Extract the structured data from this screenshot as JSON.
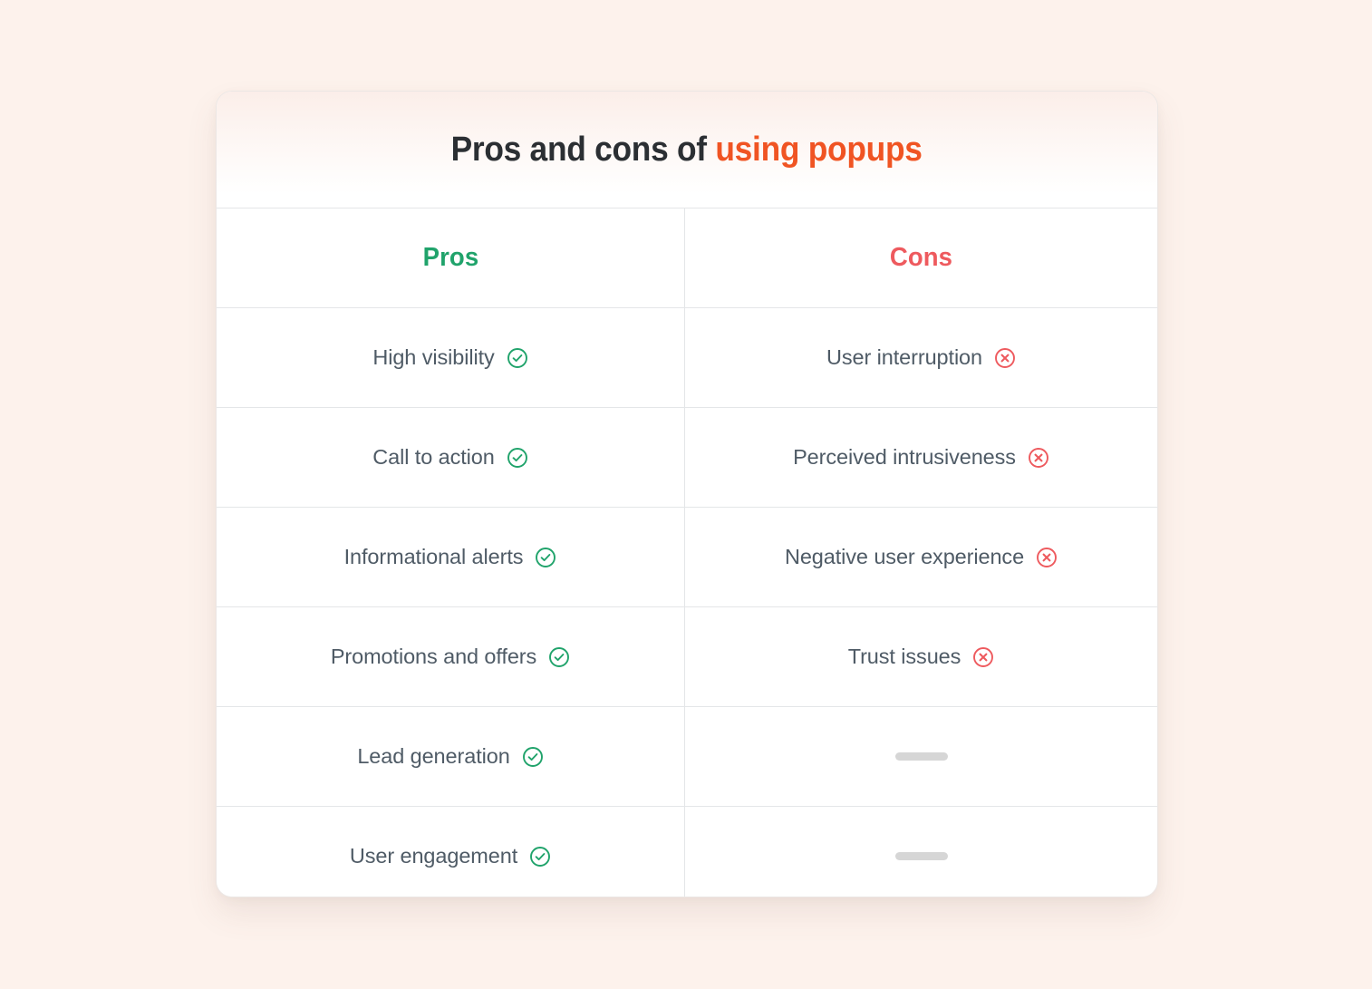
{
  "page": {
    "background_color": "#fdf2ec"
  },
  "card": {
    "title": {
      "plain": "Pros and cons of",
      "accent": "using popups",
      "plain_color": "#2b2f33",
      "accent_color": "#f05423"
    }
  },
  "table": {
    "columns": [
      {
        "label": "Pros",
        "color": "#20a36b"
      },
      {
        "label": "Cons",
        "color": "#ee5a5e"
      }
    ],
    "icons": {
      "pro": "check-circle-icon",
      "con": "x-circle-icon",
      "empty": "dash-placeholder"
    },
    "icon_colors": {
      "pro": "#20a36b",
      "con": "#ee5a5e",
      "empty": "#d6d6d6"
    },
    "rows": [
      {
        "pro": "High visibility",
        "con": "User interruption"
      },
      {
        "pro": "Call to action",
        "con": "Perceived intrusiveness"
      },
      {
        "pro": "Informational alerts",
        "con": "Negative user experience"
      },
      {
        "pro": "Promotions and offers",
        "con": "Trust issues"
      },
      {
        "pro": "Lead generation",
        "con": ""
      },
      {
        "pro": "User engagement",
        "con": ""
      }
    ]
  }
}
